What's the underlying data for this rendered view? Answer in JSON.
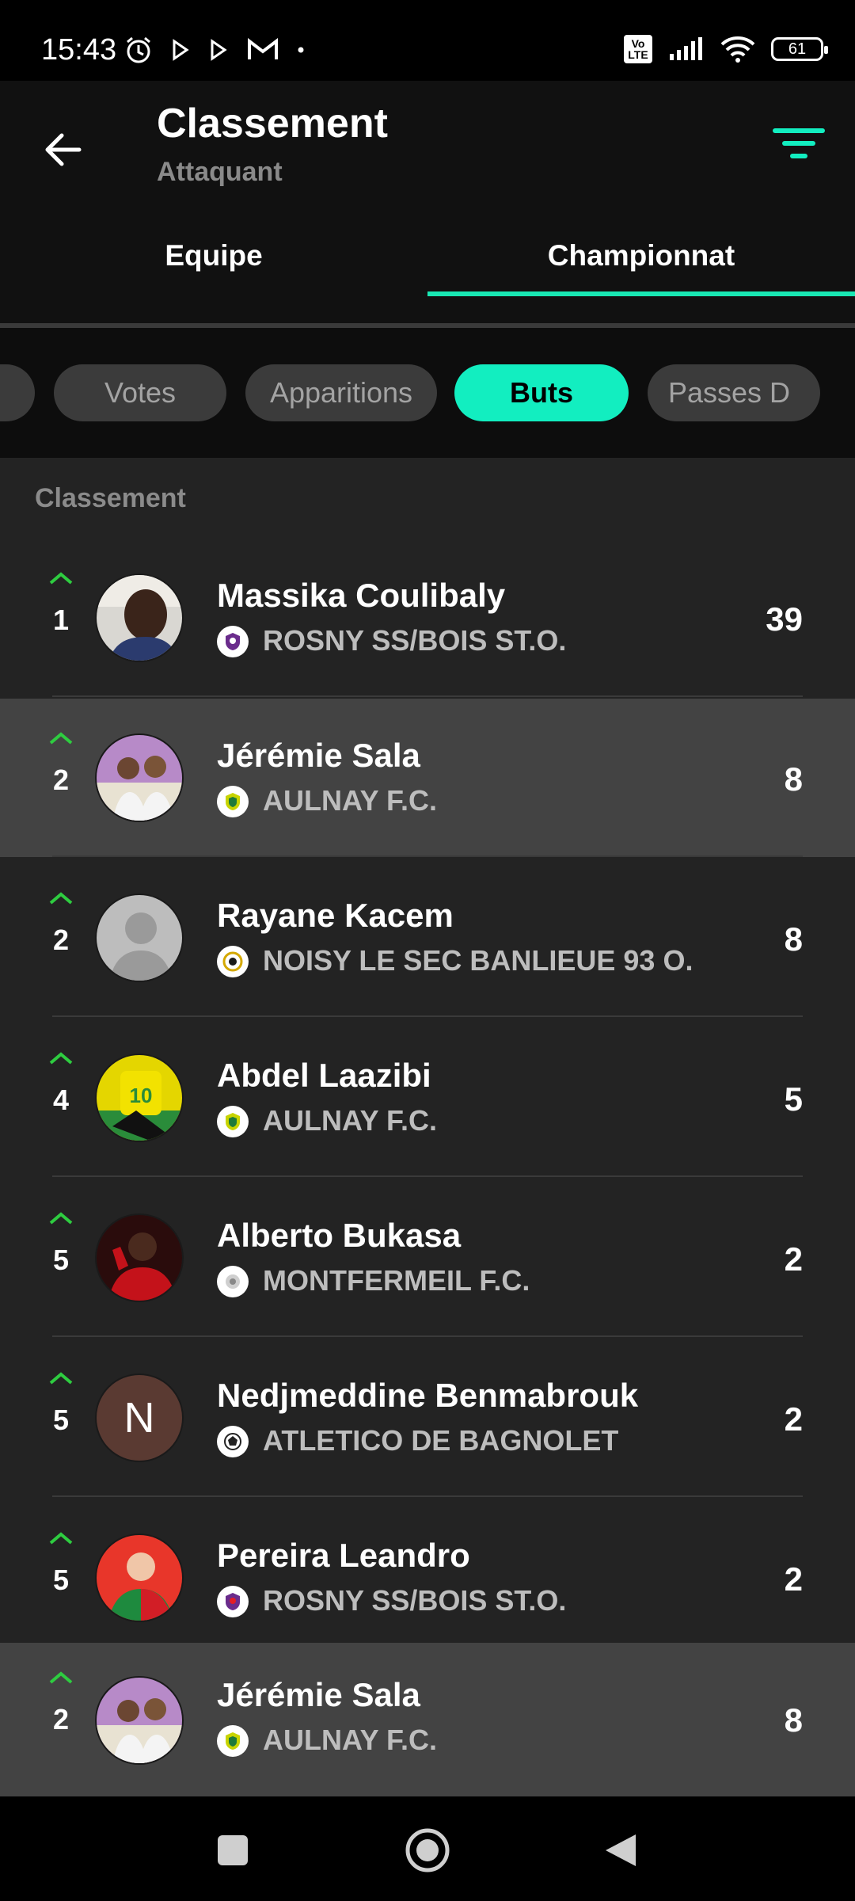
{
  "status_bar": {
    "time": "15:43",
    "volte": "Vo LTE",
    "battery": "61"
  },
  "header": {
    "title": "Classement",
    "subtitle": "Attaquant"
  },
  "tabs": [
    {
      "label": "Equipe",
      "active": false
    },
    {
      "label": "Championnat",
      "active": true
    }
  ],
  "chips": [
    {
      "label": "",
      "active": false
    },
    {
      "label": "Votes",
      "active": false
    },
    {
      "label": "Apparitions",
      "active": false
    },
    {
      "label": "Buts",
      "active": true
    },
    {
      "label": "Passes D",
      "active": false
    }
  ],
  "list": {
    "section_label": "Classement",
    "rows": [
      {
        "rank": "1",
        "name": "Massika Coulibaly",
        "team": "ROSNY SS/BOIS ST.O.",
        "value": "39",
        "highlighted": false
      },
      {
        "rank": "2",
        "name": "Jérémie Sala",
        "team": "AULNAY F.C.",
        "value": "8",
        "highlighted": true
      },
      {
        "rank": "2",
        "name": "Rayane Kacem",
        "team": "NOISY LE SEC BANLIEUE 93 O.",
        "value": "8",
        "highlighted": false
      },
      {
        "rank": "4",
        "name": "Abdel Laazibi",
        "team": "AULNAY F.C.",
        "value": "5",
        "highlighted": false
      },
      {
        "rank": "5",
        "name": "Alberto Bukasa",
        "team": "MONTFERMEIL F.C.",
        "value": "2",
        "highlighted": false
      },
      {
        "rank": "5",
        "name": "Nedjmeddine Benmabrouk",
        "team": "ATLETICO DE BAGNOLET",
        "value": "2",
        "highlighted": false,
        "avatar_initial": "N"
      },
      {
        "rank": "5",
        "name": "Pereira Leandro",
        "team": "ROSNY SS/BOIS ST.O.",
        "value": "2",
        "highlighted": false
      },
      {
        "rank": "2",
        "name": "Jérémie Sala",
        "team": "AULNAY F.C.",
        "value": "8",
        "highlighted": true
      }
    ]
  },
  "colors": {
    "accent": "#12eec0",
    "rank_up": "#2ecc40",
    "highlight_row": "#434343"
  }
}
